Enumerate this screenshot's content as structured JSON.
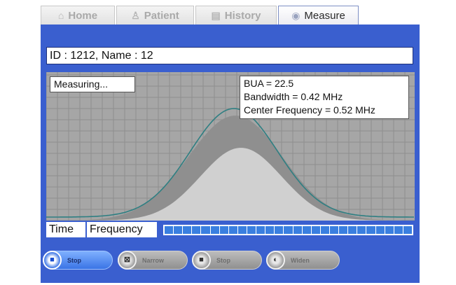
{
  "tabs": [
    {
      "label": "Home",
      "icon": "home-icon",
      "glyph": "⌂",
      "active": false
    },
    {
      "label": "Patient",
      "icon": "patient-icon",
      "glyph": "♙",
      "active": false
    },
    {
      "label": "History",
      "icon": "history-icon",
      "glyph": "▤",
      "active": false
    },
    {
      "label": "Measure",
      "icon": "measure-icon",
      "glyph": "◉",
      "active": true
    }
  ],
  "patient_line": "ID : 1212, Name : 12",
  "status_text": "Measuring...",
  "results": {
    "bua": "BUA = 22.5",
    "bandwidth": "Bandwidth = 0.42 MHz",
    "center_frequency": "Center Frequency = 0.52 MHz"
  },
  "mode": {
    "time_label": "Time",
    "frequency_label": "Frequency"
  },
  "progress_segments": 27,
  "controls": [
    {
      "label": "Stop",
      "icon": "stop-icon",
      "glyph": "■",
      "enabled": true
    },
    {
      "label": "Narrow",
      "icon": "narrow-icon",
      "glyph": "⊠",
      "enabled": false
    },
    {
      "label": "Stop",
      "icon": "stop-icon",
      "glyph": "■",
      "enabled": false
    },
    {
      "label": "Widen",
      "icon": "widen-icon",
      "glyph": "◐",
      "enabled": false
    }
  ],
  "colors": {
    "panel_blue": "#3a5fcf",
    "curve": "#2e7f82",
    "progress": "#3a7fe0",
    "plot_background": "#a6a6a6"
  }
}
